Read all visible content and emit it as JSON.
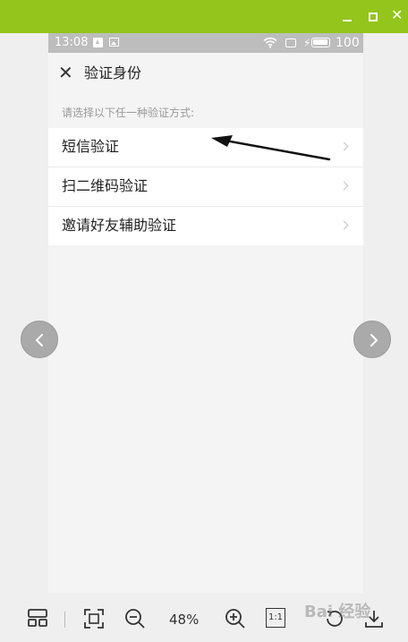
{
  "viewer": {
    "accent_color": "#93c51c",
    "window_buttons": [
      "minimize-icon",
      "maximize-icon",
      "close-icon"
    ],
    "close_glyph": "✕"
  },
  "phone": {
    "status": {
      "time": "13:08",
      "charging_glyph": "⚡",
      "battery_level": "100"
    },
    "header": {
      "close_glyph": "✕",
      "title": "验证身份"
    },
    "instruction": "请选择以下任一种验证方式:",
    "options": [
      {
        "label": "短信验证"
      },
      {
        "label": "扫二维码验证"
      },
      {
        "label": "邀请好友辅助验证"
      }
    ]
  },
  "navigation": {
    "prev": "chevron-left-icon",
    "next": "chevron-right-icon"
  },
  "toolbar": {
    "zoom_level": "48%",
    "actual_size_label": "1:1",
    "watermark": "Bai 经验"
  }
}
